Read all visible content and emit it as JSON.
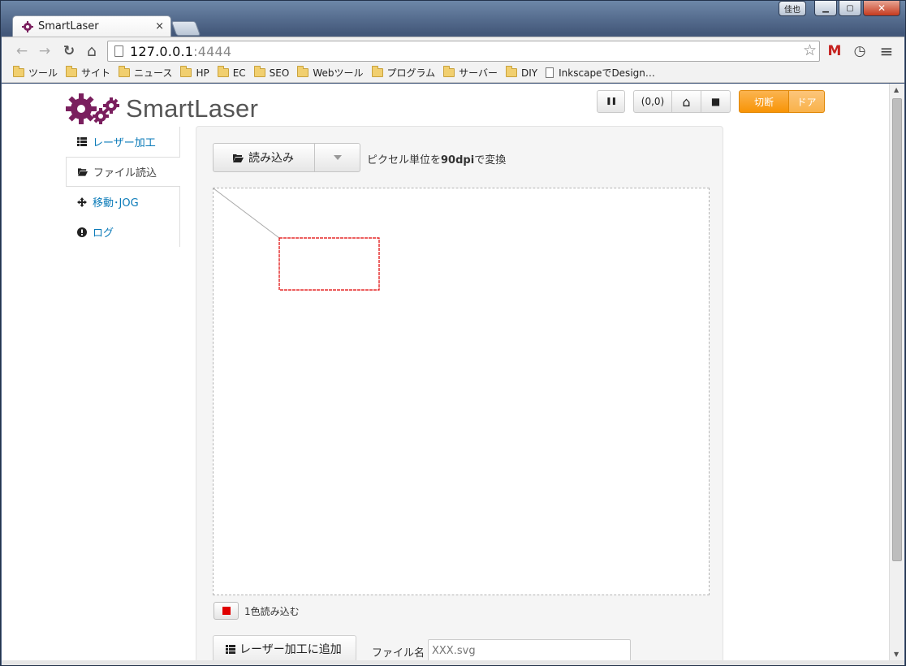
{
  "browser": {
    "tab_title": "SmartLaser",
    "tab_close": "×",
    "window_user": "佳也",
    "window_min": "▁",
    "window_max": "▢",
    "window_close": "✕",
    "url_host": "127.0.0.1",
    "url_port": ":4444",
    "back": "←",
    "forward": "→",
    "reload": "↻",
    "home": "⌂",
    "star": "☆",
    "gmail": "M",
    "clock": "◷",
    "menu": "≡",
    "bookmarks": [
      {
        "label": "ツール",
        "type": "folder"
      },
      {
        "label": "サイト",
        "type": "folder"
      },
      {
        "label": "ニュース",
        "type": "folder"
      },
      {
        "label": "HP",
        "type": "folder"
      },
      {
        "label": "EC",
        "type": "folder"
      },
      {
        "label": "SEO",
        "type": "folder"
      },
      {
        "label": "Webツール",
        "type": "folder"
      },
      {
        "label": "プログラム",
        "type": "folder"
      },
      {
        "label": "サーバー",
        "type": "folder"
      },
      {
        "label": "DIY",
        "type": "folder"
      },
      {
        "label": "InkscapeでDesign…",
        "type": "page"
      }
    ]
  },
  "app": {
    "brand": "SmartLaser",
    "controls": {
      "pause_icon": "❚❚",
      "origin_label": "(0,0)",
      "home_icon": "⌂",
      "stop_icon": "■",
      "status_cut": "切断",
      "status_door": "ドア"
    },
    "nav": [
      {
        "label": "レーザー加工",
        "icon": "list-icon",
        "active": false
      },
      {
        "label": "ファイル読込",
        "icon": "folder-open-icon",
        "active": true
      },
      {
        "label": "移動･JOG",
        "icon": "move-icon",
        "active": false
      },
      {
        "label": "ログ",
        "icon": "exclamation-circle-icon",
        "active": false
      }
    ],
    "file_panel": {
      "read_button": "読み込み",
      "dpi_prefix": "ピクセル単位を",
      "dpi_value": "90dpi",
      "dpi_suffix": "で変換",
      "color_label": "1色読み込む",
      "add_button": "レーザー加工に追加",
      "filename_label": "ファイル名",
      "filename_placeholder": "XXX.svg"
    },
    "colors": {
      "accent_orange": "#f89406",
      "link_blue": "#0a7ab8",
      "path_red": "#e00000",
      "logo_purple": "#7a1f5e"
    }
  }
}
